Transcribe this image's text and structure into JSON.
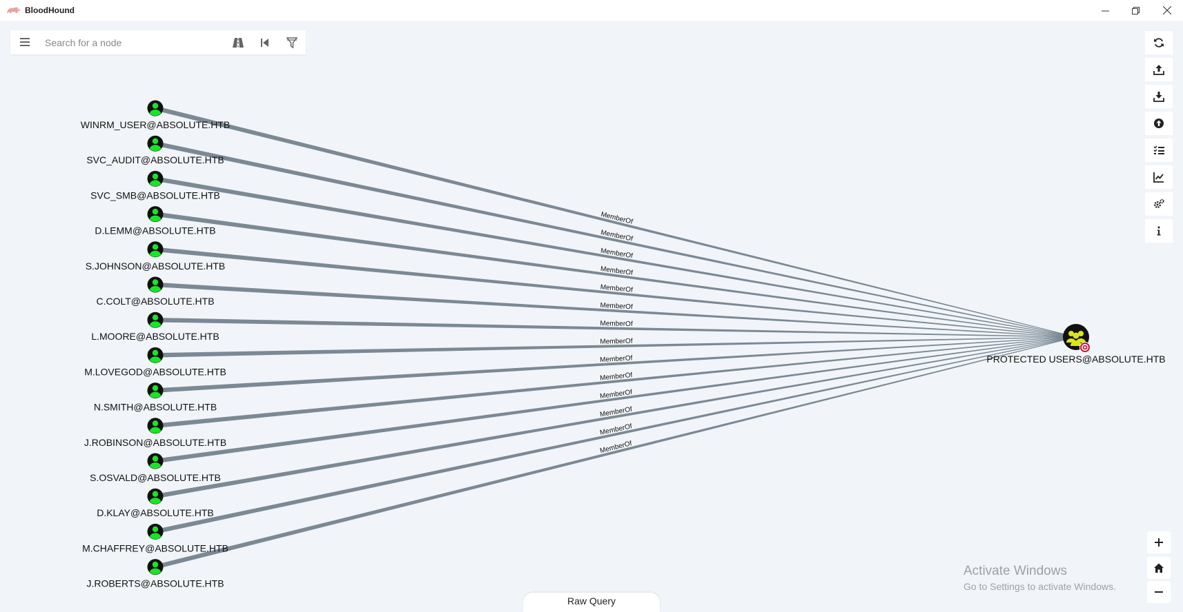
{
  "window": {
    "title": "BloodHound",
    "minimize_symbol": "—",
    "restore_symbol": "❐",
    "close_symbol": "✕"
  },
  "search": {
    "placeholder": "Search for a node",
    "icons": [
      "menu-icon",
      "pathfinding-icon",
      "back-icon",
      "filter-icon"
    ]
  },
  "toolbar": {
    "icons": [
      "refresh-icon",
      "export-icon",
      "import-icon",
      "upload-icon",
      "queries-icon",
      "chart-icon",
      "settings-icon",
      "info-icon"
    ]
  },
  "zoom": {
    "icons": [
      "zoom-in-icon",
      "home-icon",
      "zoom-out-icon"
    ]
  },
  "graph": {
    "edge_label": "MemberOf",
    "edge_color": "#7b8994",
    "user_node_color": "#17e625",
    "group_node_color": "#dbe617",
    "target": "PROTECTED USERS@ABSOLUTE.HTB",
    "users": [
      "WINRM_USER@ABSOLUTE.HTB",
      "SVC_AUDIT@ABSOLUTE.HTB",
      "SVC_SMB@ABSOLUTE.HTB",
      "D.LEMM@ABSOLUTE.HTB",
      "S.JOHNSON@ABSOLUTE.HTB",
      "C.COLT@ABSOLUTE.HTB",
      "L.MOORE@ABSOLUTE.HTB",
      "M.LOVEGOD@ABSOLUTE.HTB",
      "N.SMITH@ABSOLUTE.HTB",
      "J.ROBINSON@ABSOLUTE.HTB",
      "S.OSVALD@ABSOLUTE.HTB",
      "D.KLAY@ABSOLUTE.HTB",
      "M.CHAFFREY@ABSOLUTE.HTB",
      "J.ROBERTS@ABSOLUTE.HTB"
    ]
  },
  "watermark": {
    "title": "Activate Windows",
    "subtitle": "Go to Settings to activate Windows."
  },
  "raw_query": {
    "label": "Raw Query"
  }
}
